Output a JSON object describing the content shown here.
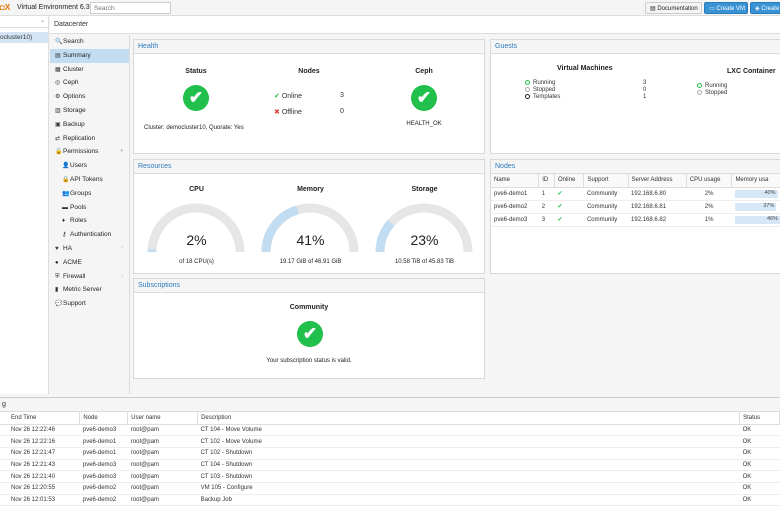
{
  "app": {
    "logo": "◘X",
    "name": "Virtual Environment 6.3-2",
    "search_placeholder": "Search",
    "doc_btn": "Documentation",
    "create_vm": "Create VM",
    "create_ct": "Create"
  },
  "tree": {
    "node": "ocluster10)"
  },
  "title": "Datacenter",
  "menu": [
    {
      "icon": "🔍",
      "label": "Search",
      "name": "menu-search"
    },
    {
      "icon": "▤",
      "label": "Summary",
      "name": "menu-summary",
      "selected": true
    },
    {
      "icon": "▦",
      "label": "Cluster",
      "name": "menu-cluster"
    },
    {
      "icon": "◎",
      "label": "Ceph",
      "name": "menu-ceph"
    },
    {
      "icon": "⚙",
      "label": "Options",
      "name": "menu-options"
    },
    {
      "icon": "▥",
      "label": "Storage",
      "name": "menu-storage"
    },
    {
      "icon": "▣",
      "label": "Backup",
      "name": "menu-backup"
    },
    {
      "icon": "⇄",
      "label": "Replication",
      "name": "menu-replication"
    },
    {
      "icon": "🔓",
      "label": "Permissions",
      "name": "menu-permissions",
      "arrow": "▾"
    },
    {
      "icon": "👤",
      "label": "Users",
      "name": "menu-users",
      "sub": true
    },
    {
      "icon": "🔒",
      "label": "API Tokens",
      "name": "menu-api-tokens",
      "sub": true
    },
    {
      "icon": "👥",
      "label": "Groups",
      "name": "menu-groups",
      "sub": true
    },
    {
      "icon": "▬",
      "label": "Pools",
      "name": "menu-pools",
      "sub": true
    },
    {
      "icon": "♦",
      "label": "Roles",
      "name": "menu-roles",
      "sub": true
    },
    {
      "icon": "⚷",
      "label": "Authentication",
      "name": "menu-authentication",
      "sub": true
    },
    {
      "icon": "♥",
      "label": "HA",
      "name": "menu-ha",
      "arrow": "›"
    },
    {
      "icon": "●",
      "label": "ACME",
      "name": "menu-acme"
    },
    {
      "icon": "⛨",
      "label": "Firewall",
      "name": "menu-firewall",
      "arrow": "›"
    },
    {
      "icon": "▮",
      "label": "Metric Server",
      "name": "menu-metric-server"
    },
    {
      "icon": "💬",
      "label": "Support",
      "name": "menu-support"
    }
  ],
  "health": {
    "header": "Health",
    "status_title": "Status",
    "nodes_title": "Nodes",
    "ceph_title": "Ceph",
    "online_label": "Online",
    "online_count": "3",
    "offline_label": "Offline",
    "offline_count": "0",
    "cluster_text": "Cluster: democluster10, Quorate: Yes",
    "ceph_status": "HEALTH_OK"
  },
  "guests": {
    "header": "Guests",
    "vm_title": "Virtual Machines",
    "lxc_title": "LXC Container",
    "vm": [
      {
        "label": "Running",
        "count": "3"
      },
      {
        "label": "Stopped",
        "count": "0"
      },
      {
        "label": "Templates",
        "count": "1"
      }
    ],
    "lxc": [
      {
        "label": "Running"
      },
      {
        "label": "Stopped"
      }
    ]
  },
  "resources": {
    "header": "Resources",
    "cpu": {
      "title": "CPU",
      "value": "2%",
      "sub": "of 18 CPU(s)",
      "fraction": 0.02
    },
    "memory": {
      "title": "Memory",
      "value": "41%",
      "sub": "19.17 GiB of 46.91 GiB",
      "fraction": 0.41
    },
    "storage": {
      "title": "Storage",
      "value": "23%",
      "sub": "10.58 TiB of 45.83 TiB",
      "fraction": 0.23
    }
  },
  "nodes": {
    "header": "Nodes",
    "columns": [
      "Name",
      "ID",
      "Online",
      "Support",
      "Server Address",
      "CPU usage",
      "Memory usa"
    ],
    "rows": [
      {
        "name": "pve6-demo1",
        "id": "1",
        "online": "✔",
        "support": "Community",
        "addr": "192.168.6.80",
        "cpu": "2%",
        "mem": "40%",
        "memf": 0.4
      },
      {
        "name": "pve6-demo2",
        "id": "2",
        "online": "✔",
        "support": "Community",
        "addr": "192.168.6.81",
        "cpu": "2%",
        "mem": "37%",
        "memf": 0.37
      },
      {
        "name": "pve6-demo3",
        "id": "3",
        "online": "✔",
        "support": "Community",
        "addr": "192.168.6.82",
        "cpu": "1%",
        "mem": "46%",
        "memf": 0.46
      }
    ]
  },
  "subscriptions": {
    "header": "Subscriptions",
    "title": "Community",
    "text": "Your subscription status is valid."
  },
  "log": {
    "header": "g",
    "columns": [
      "End Time",
      "Node",
      "User name",
      "Description",
      "Status"
    ],
    "rows": [
      [
        "Nov 26 12:22:46",
        "pve6-demo3",
        "root@pam",
        "CT 104 - Move Volume",
        "OK"
      ],
      [
        "Nov 26 12:22:16",
        "pve6-demo1",
        "root@pam",
        "CT 102 - Move Volume",
        "OK"
      ],
      [
        "Nov 26 12:21:47",
        "pve6-demo1",
        "root@pam",
        "CT 102 - Shutdown",
        "OK"
      ],
      [
        "Nov 26 12:21:43",
        "pve6-demo3",
        "root@pam",
        "CT 104 - Shutdown",
        "OK"
      ],
      [
        "Nov 26 12:21:40",
        "pve6-demo3",
        "root@pam",
        "CT 103 - Shutdown",
        "OK"
      ],
      [
        "Nov 26 12:20:55",
        "pve6-demo2",
        "root@pam",
        "VM 105 - Configure",
        "OK"
      ],
      [
        "Nov 26 12:01:53",
        "pve6-demo2",
        "root@pam",
        "Backup Job",
        "OK"
      ]
    ]
  },
  "colors": {
    "accent": "#3892d4",
    "ok": "#21bf4b",
    "header_blue": "#2d7bbd"
  }
}
